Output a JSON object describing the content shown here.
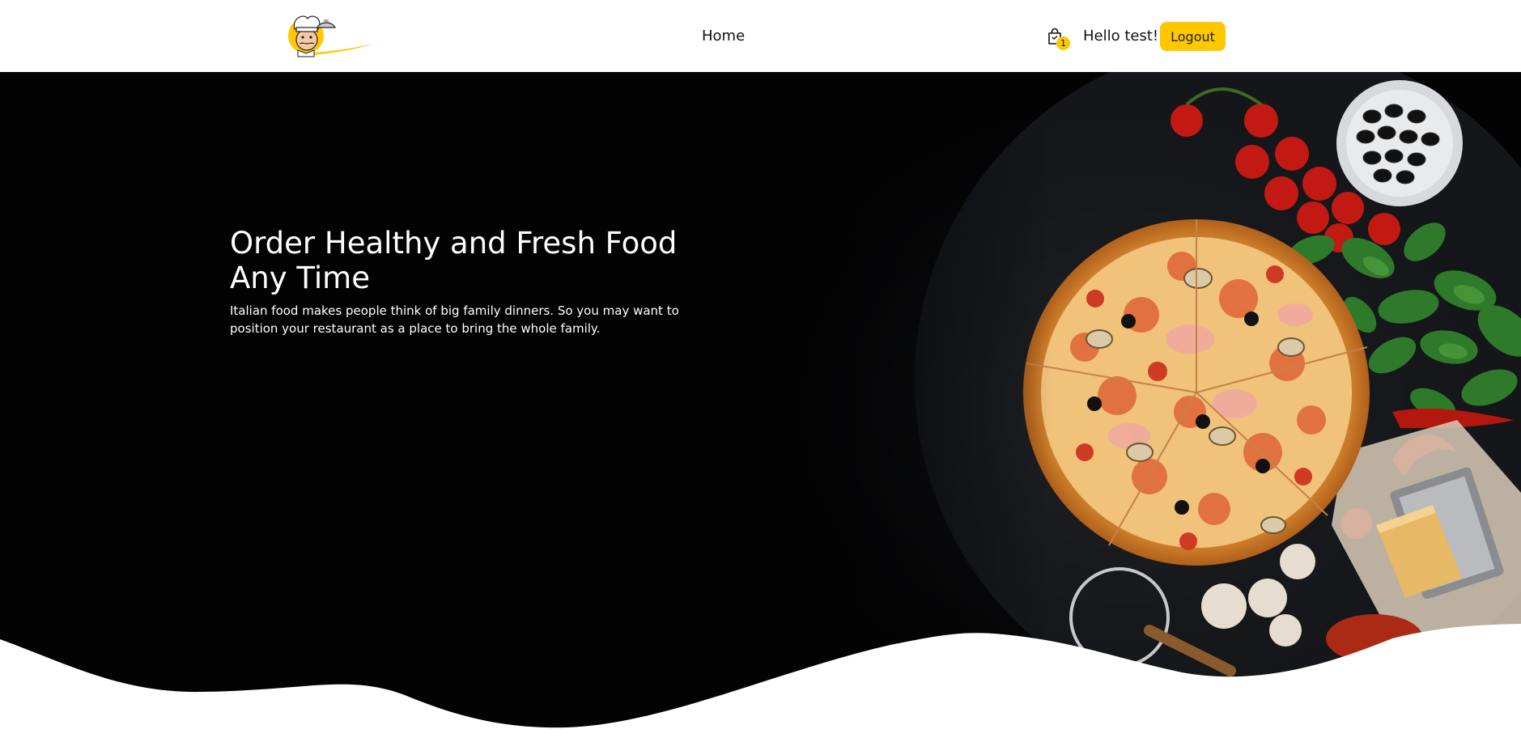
{
  "header": {
    "nav": {
      "home_label": "Home"
    },
    "cart": {
      "count": "1"
    },
    "greeting": "Hello test!",
    "logout_label": "Logout"
  },
  "hero": {
    "title": "Order Healthy and Fresh Food Any Time",
    "description": "Italian food makes people think of big family dinners. So you may want to position your restaurant as a place to bring the whole family."
  },
  "colors": {
    "accent": "#ffc700",
    "hero_background": "#030304",
    "text_light": "#ffffff",
    "text_dark": "#111111"
  },
  "icons": {
    "logo": "chef-mascot-logo",
    "cart": "shopping-bag-icon"
  }
}
